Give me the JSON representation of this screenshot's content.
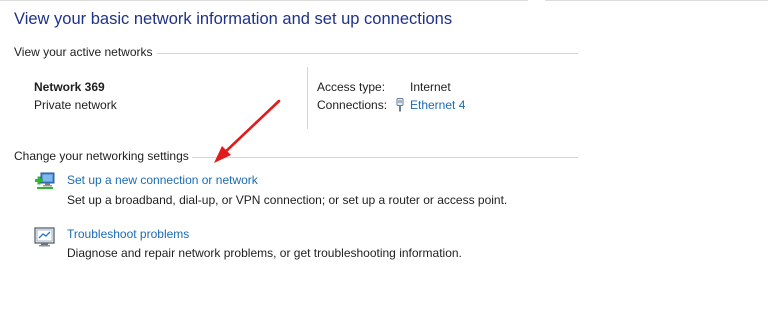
{
  "page": {
    "title": "View your basic network information and set up connections"
  },
  "active_networks": {
    "header": "View your active networks",
    "network_name": "Network 369",
    "network_category": "Private network",
    "access_type_label": "Access type:",
    "access_type_value": "Internet",
    "connections_label": "Connections:",
    "connections_value": "Ethernet 4",
    "connections_icon": "ethernet-plug-icon"
  },
  "networking_settings": {
    "header": "Change your networking settings",
    "tasks": [
      {
        "label": "Set up a new connection or network",
        "description": "Set up a broadband, dial-up, or VPN connection; or set up a router or access point.",
        "icon": "new-connection-icon"
      },
      {
        "label": "Troubleshoot problems",
        "description": "Diagnose and repair network problems, or get troubleshooting information.",
        "icon": "troubleshoot-icon"
      }
    ]
  },
  "colors": {
    "title": "#1e3287",
    "link": "#1a6bb5",
    "annotation_arrow": "#e11b1b"
  }
}
